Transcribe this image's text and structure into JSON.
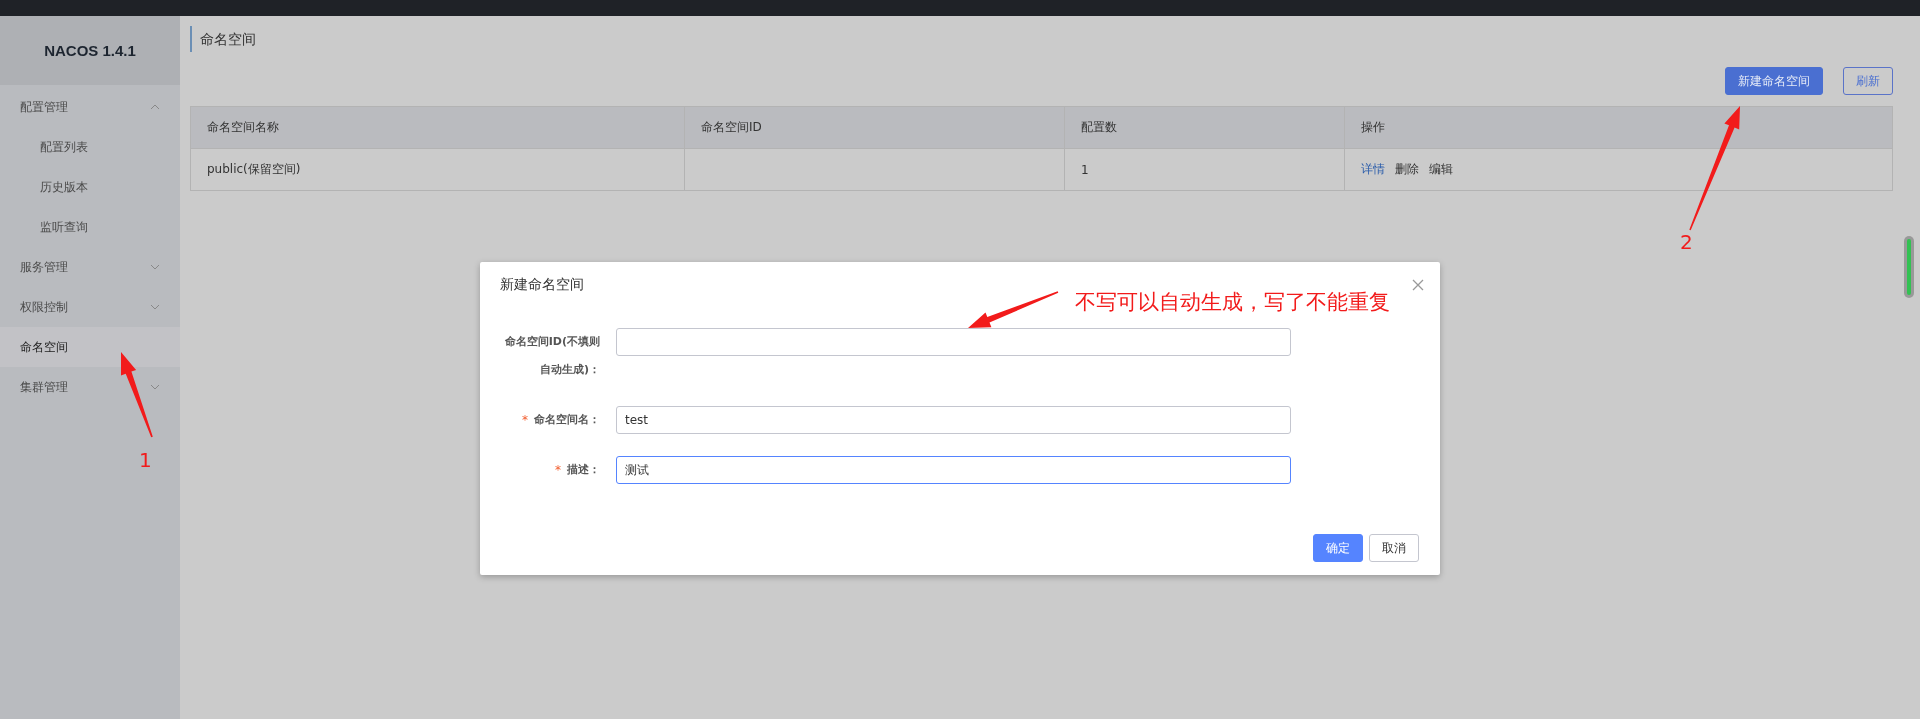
{
  "sidebar": {
    "logo": "NACOS 1.4.1",
    "items": [
      {
        "label": "配置管理",
        "expanded": true,
        "selected": false,
        "children": [
          {
            "label": "配置列表",
            "selected": false
          },
          {
            "label": "历史版本",
            "selected": false
          },
          {
            "label": "监听查询",
            "selected": false
          }
        ]
      },
      {
        "label": "服务管理",
        "expanded": false,
        "selected": false
      },
      {
        "label": "权限控制",
        "expanded": false,
        "selected": false
      },
      {
        "label": "命名空间",
        "selected": true
      },
      {
        "label": "集群管理",
        "expanded": false,
        "selected": false
      }
    ]
  },
  "page": {
    "title": "命名空间",
    "buttons": [
      {
        "label": "新建命名空间",
        "kind": "primary"
      },
      {
        "label": "刷新",
        "kind": "outline"
      }
    ]
  },
  "table": {
    "columns": [
      "命名空间名称",
      "命名空间ID",
      "配置数",
      "操作"
    ],
    "rows": [
      {
        "cells": [
          "public(保留空间)",
          null,
          "1"
        ],
        "actions": [
          {
            "label": "详情",
            "kind": "link"
          },
          {
            "label": "删除",
            "kind": "text"
          },
          {
            "label": "编辑",
            "kind": "text"
          }
        ]
      }
    ]
  },
  "dialog": {
    "title": "新建命名空间",
    "fields": [
      {
        "label": "命名空间ID(不填则自动生成)：",
        "focused": false
      },
      {
        "label": "命名空间名：",
        "required_mark": "*",
        "value": "test",
        "focused": false
      },
      {
        "label": "描述：",
        "required_mark": "*",
        "value": "测试",
        "focused": true
      }
    ],
    "buttons": [
      {
        "label": "确定",
        "kind": "primary"
      },
      {
        "label": "取消",
        "kind": "normal"
      }
    ]
  },
  "annotations": [
    {
      "text": "不写可以自动生成，写了不能重复"
    },
    {
      "text": "1"
    },
    {
      "text": "2"
    }
  ]
}
